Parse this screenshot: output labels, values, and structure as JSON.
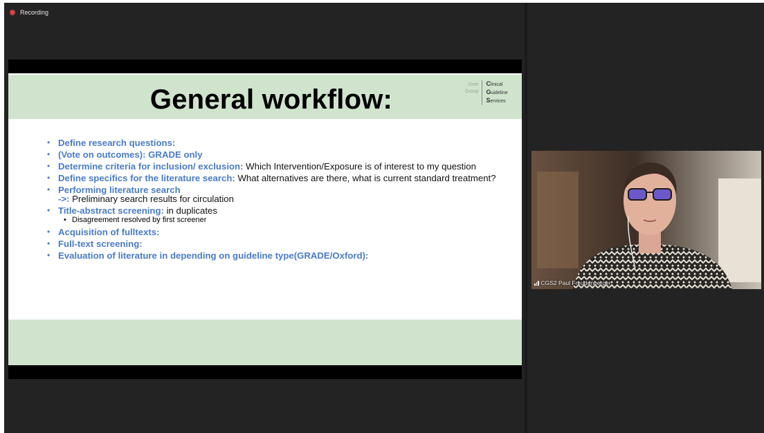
{
  "recording": {
    "label": "Recording",
    "dot_color": "#e04a4a"
  },
  "slide": {
    "title": "General workflow:",
    "logo": {
      "group_line1": "User",
      "group_line2": "Group",
      "line1_initial": "C",
      "line1_rest": "linical",
      "line2_initial": "G",
      "line2_rest": "uideline",
      "line3_initial": "S",
      "line3_rest": "ervices"
    },
    "items": [
      {
        "bold": "Define research questions:",
        "text": ""
      },
      {
        "bold": "(Vote on outcomes): GRADE only",
        "text": ""
      },
      {
        "bold": "Determine criteria for inclusion/ exclusion:",
        "text": " Which Intervention/Exposure is of interest to my question"
      },
      {
        "bold": "Define specifics for the literature search:",
        "text": " What alternatives are there, what is current standard treatment?"
      },
      {
        "bold": "Performing literature search",
        "bold2": "->:",
        "text": " Preliminary search results for circulation"
      },
      {
        "bold": "Title-abstract screening:",
        "text": " in duplicates",
        "sub": "Disagreement resolved by first screener"
      },
      {
        "bold": "Acquisition of fulltexts:",
        "text": ""
      },
      {
        "bold": "Full-text screening:",
        "text": ""
      },
      {
        "bold": "Evaluation of literature in depending on guideline type(GRADE/Oxford):",
        "text": ""
      }
    ],
    "header_color": "#cfe3cd",
    "accent_color": "#4a7bc8"
  },
  "participant": {
    "name": "CGS2 Paul Freudenberger"
  }
}
